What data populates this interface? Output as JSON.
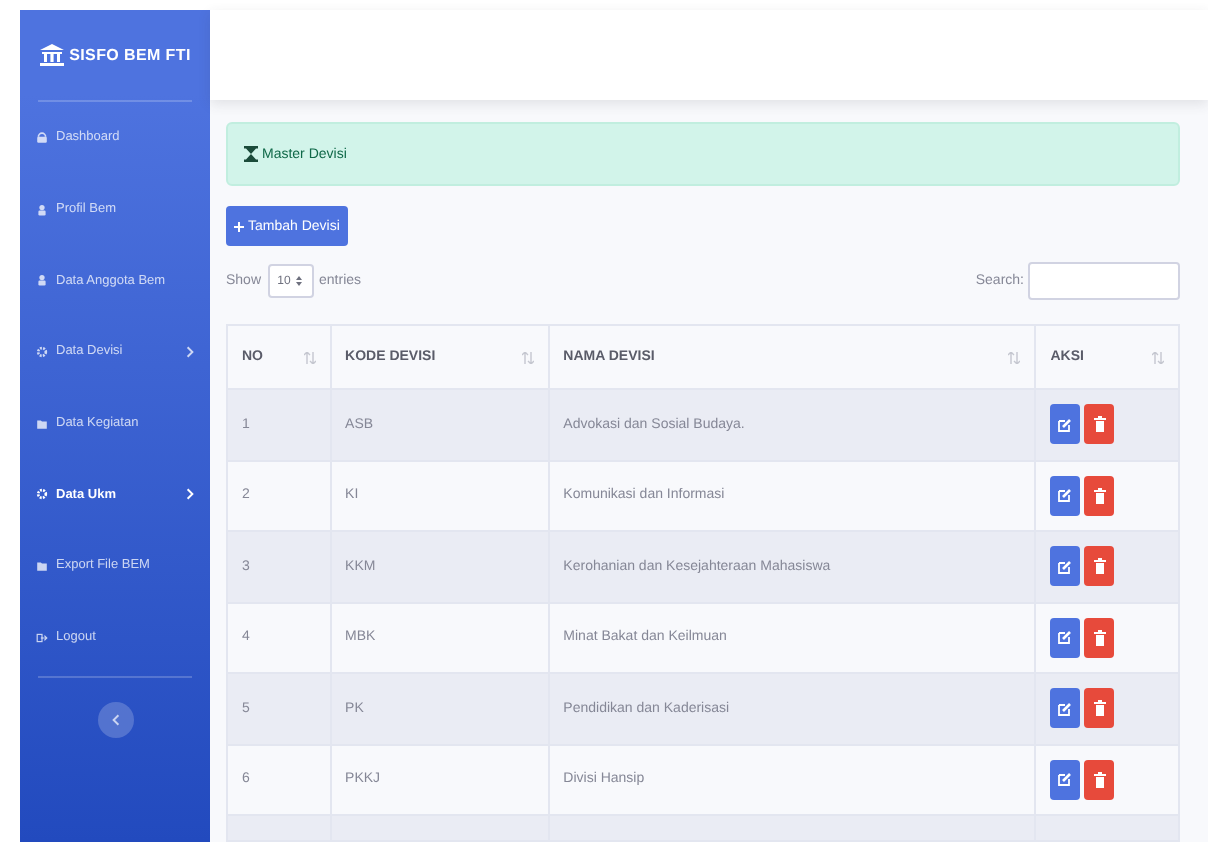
{
  "sidebar": {
    "brand": "SISFO BEM FTI",
    "items": [
      {
        "label": "Dashboard",
        "active": false,
        "has_submenu": false
      },
      {
        "label": "Profil Bem",
        "active": false,
        "has_submenu": false
      },
      {
        "label": "Data Anggota Bem",
        "active": false,
        "has_submenu": false
      },
      {
        "label": "Data Devisi",
        "active": false,
        "has_submenu": true
      },
      {
        "label": "Data Kegiatan",
        "active": false,
        "has_submenu": false
      },
      {
        "label": "Data Ukm",
        "active": true,
        "has_submenu": true
      },
      {
        "label": "Export File BEM",
        "active": false,
        "has_submenu": false
      },
      {
        "label": "Logout",
        "active": false,
        "has_submenu": false
      }
    ]
  },
  "alert": {
    "title": "Master Devisi"
  },
  "add_button": "Tambah Devisi",
  "length_control": {
    "before": "Show",
    "value": "10",
    "after": "entries"
  },
  "search": {
    "label": "Search:"
  },
  "table": {
    "columns": [
      "NO",
      "KODE DEVISI",
      "NAMA DEVISI",
      "AKSI"
    ],
    "rows": [
      {
        "no": "1",
        "code": "ASB",
        "name": "Advokasi dan Sosial Budaya."
      },
      {
        "no": "2",
        "code": "KI",
        "name": "Komunikasi dan Informasi"
      },
      {
        "no": "3",
        "code": "KKM",
        "name": "Kerohanian dan Kesejahteraan Mahasiswa"
      },
      {
        "no": "4",
        "code": "MBK",
        "name": "Minat Bakat dan Keilmuan"
      },
      {
        "no": "5",
        "code": "PK",
        "name": "Pendidikan dan Kaderisasi"
      },
      {
        "no": "6",
        "code": "PKKJ",
        "name": "Divisi Hansip"
      }
    ]
  }
}
